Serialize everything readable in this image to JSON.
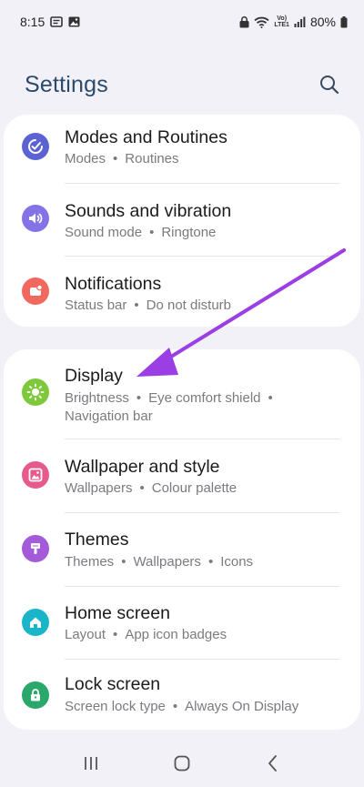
{
  "status_bar": {
    "time": "8:15",
    "network_top": "Vo)",
    "network_bottom": "LTE1",
    "battery": "80%"
  },
  "header": {
    "title": "Settings"
  },
  "groups": [
    {
      "items": [
        {
          "title": "Modes and Routines",
          "sub": [
            "Modes",
            "Routines"
          ],
          "icon": "check-circle-icon",
          "color": "#5b63d3"
        },
        {
          "title": "Sounds and vibration",
          "sub": [
            "Sound mode",
            "Ringtone"
          ],
          "icon": "speaker-icon",
          "color": "#8473e6"
        },
        {
          "title": "Notifications",
          "sub": [
            "Status bar",
            "Do not disturb"
          ],
          "icon": "notification-icon",
          "color": "#f0685e"
        }
      ]
    },
    {
      "items": [
        {
          "title": "Display",
          "sub": [
            "Brightness",
            "Eye comfort shield"
          ],
          "sub2": "Navigation bar",
          "icon": "sun-icon",
          "color": "#7fc83b"
        },
        {
          "title": "Wallpaper and style",
          "sub": [
            "Wallpapers",
            "Colour palette"
          ],
          "icon": "image-icon",
          "color": "#e65b8c"
        },
        {
          "title": "Themes",
          "sub": [
            "Themes",
            "Wallpapers",
            "Icons"
          ],
          "icon": "theme-brush-icon",
          "color": "#a55ad9"
        },
        {
          "title": "Home screen",
          "sub": [
            "Layout",
            "App icon badges"
          ],
          "icon": "home-icon",
          "color": "#19b6c9"
        },
        {
          "title": "Lock screen",
          "sub": [
            "Screen lock type",
            "Always On Display"
          ],
          "icon": "lock-icon",
          "color": "#2aa86c"
        }
      ]
    }
  ],
  "annotation_color": "#9b3ee3"
}
